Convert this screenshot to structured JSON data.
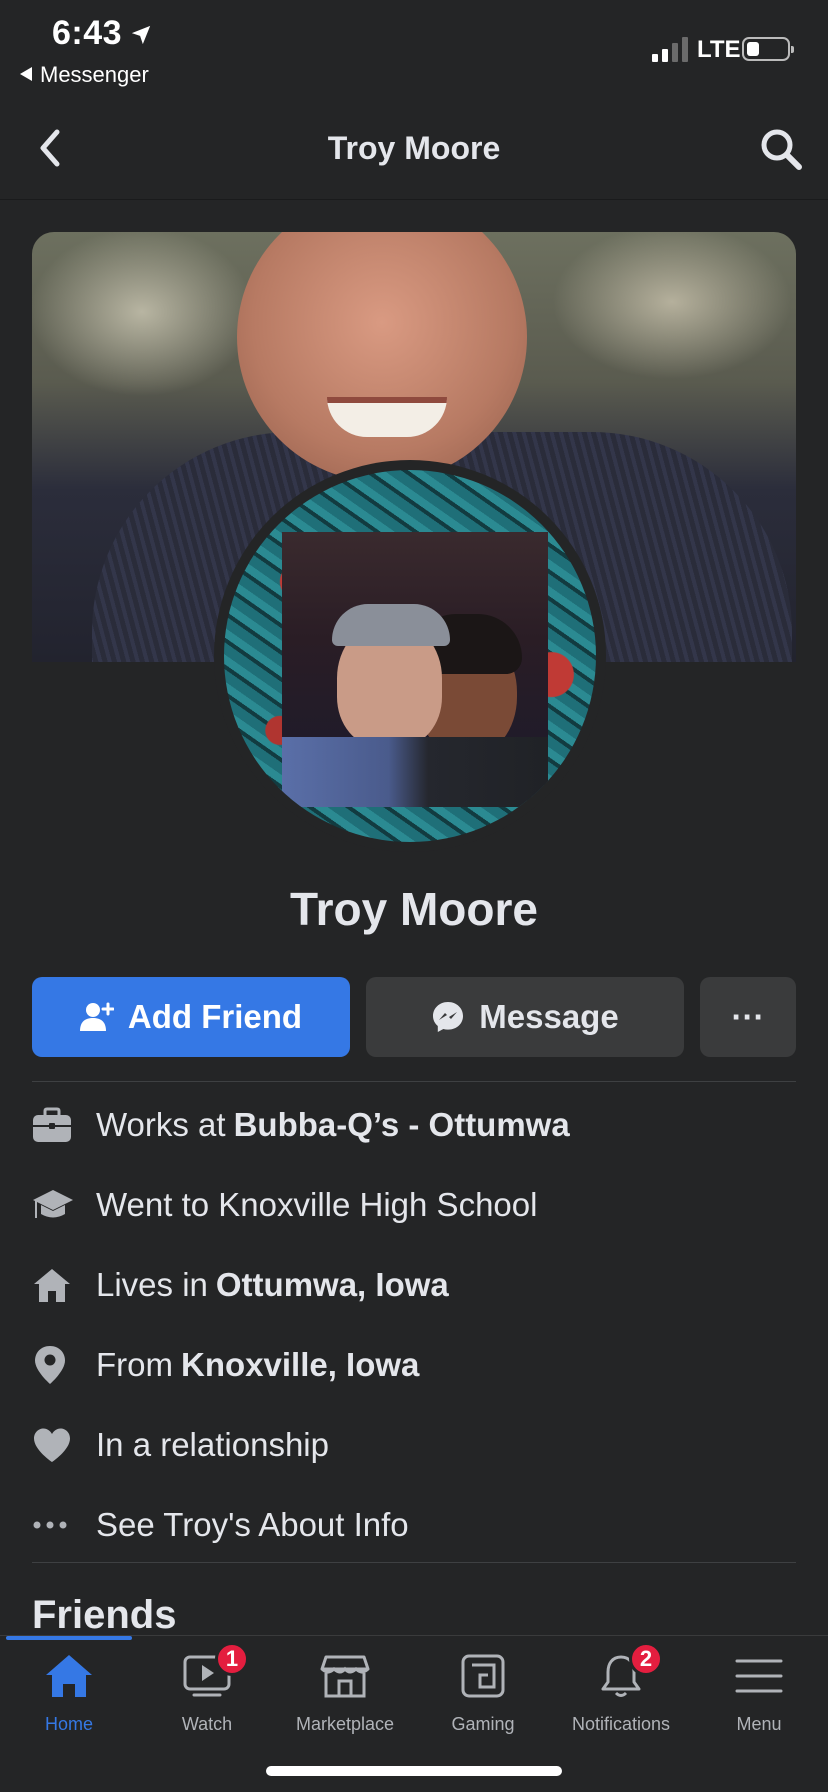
{
  "status_bar": {
    "time": "6:43",
    "back_app_label": "Messenger",
    "network": "LTE"
  },
  "header": {
    "title": "Troy Moore"
  },
  "profile": {
    "name": "Troy Moore"
  },
  "actions": {
    "add_friend_label": "Add Friend",
    "message_label": "Message",
    "more_label": "···"
  },
  "details": [
    {
      "icon": "briefcase-icon",
      "prefix": "Works at",
      "value": "Bubba-Q’s - Ottumwa"
    },
    {
      "icon": "graduation-cap-icon",
      "prefix": "Went to Knoxville High School",
      "value": ""
    },
    {
      "icon": "house-icon",
      "prefix": "Lives in",
      "value": "Ottumwa, Iowa"
    },
    {
      "icon": "location-pin-icon",
      "prefix": "From",
      "value": "Knoxville, Iowa"
    },
    {
      "icon": "heart-icon",
      "prefix": "In a relationship",
      "value": ""
    },
    {
      "icon": "more-dots-icon",
      "prefix": "See Troy's About Info",
      "value": ""
    }
  ],
  "friends": {
    "title": "Friends"
  },
  "tab_bar": {
    "tabs": [
      {
        "label": "Home",
        "icon": "home-icon",
        "active": true,
        "badge": ""
      },
      {
        "label": "Watch",
        "icon": "watch-icon",
        "active": false,
        "badge": "1"
      },
      {
        "label": "Marketplace",
        "icon": "marketplace-icon",
        "active": false,
        "badge": ""
      },
      {
        "label": "Gaming",
        "icon": "gaming-icon",
        "active": false,
        "badge": ""
      },
      {
        "label": "Notifications",
        "icon": "bell-icon",
        "active": false,
        "badge": "2"
      },
      {
        "label": "Menu",
        "icon": "menu-icon",
        "active": false,
        "badge": ""
      }
    ]
  },
  "colors": {
    "background": "#242526",
    "primary_blue": "#3578e5",
    "secondary_button": "#3a3b3c",
    "badge_red": "#e41e3f",
    "text": "#e4e6eb",
    "muted_text": "#b0b3b8"
  }
}
